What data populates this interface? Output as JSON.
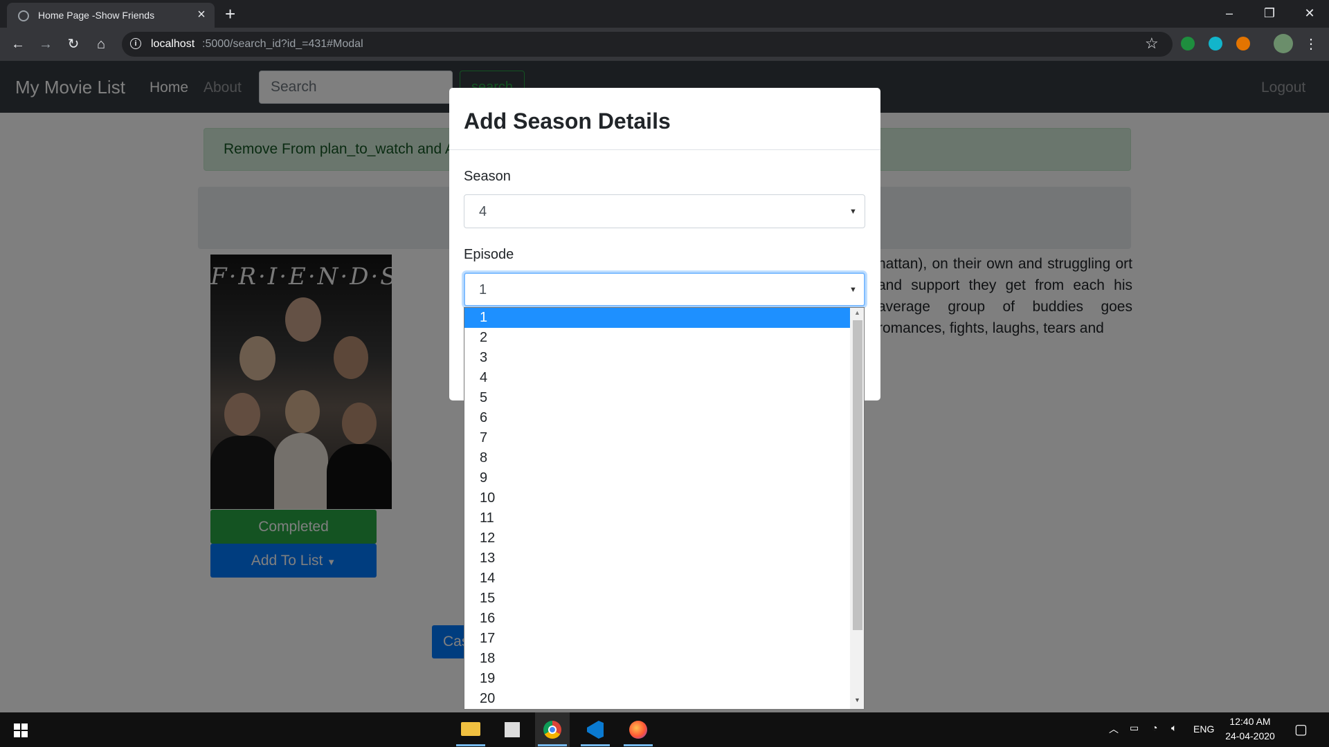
{
  "browser": {
    "tab_title": "Home Page -Show Friends",
    "url_host": "localhost",
    "url_path": ":5000/search_id?id_=431#Modal"
  },
  "navbar": {
    "brand": "My Movie List",
    "home": "Home",
    "about": "About",
    "search_placeholder": "Search",
    "search_button": "search",
    "logout": "Logout"
  },
  "alert": {
    "text": "Remove From plan_to_watch and A"
  },
  "show": {
    "poster_title": "F·R·I·E·N·D·S",
    "description": "hattan), on their own and struggling ort and support they get from each his average group of buddies goes romances, fights, laughs, tears and"
  },
  "buttons": {
    "completed": "Completed",
    "add_to_list": "Add To List",
    "cast": "Cas"
  },
  "modal": {
    "title": "Add Season Details",
    "season_label": "Season",
    "season_value": "4",
    "episode_label": "Episode",
    "episode_value": "1",
    "episode_options": [
      "1",
      "2",
      "3",
      "4",
      "5",
      "6",
      "7",
      "8",
      "9",
      "10",
      "11",
      "12",
      "13",
      "14",
      "15",
      "16",
      "17",
      "18",
      "19",
      "20"
    ],
    "selected_option": "1"
  },
  "taskbar": {
    "language": "ENG",
    "time": "12:40 AM",
    "date": "24-04-2020",
    "apps": [
      "file-explorer-icon",
      "store-icon",
      "chrome-icon",
      "vscode-icon",
      "firefox-icon"
    ]
  },
  "colors": {
    "navbar": "#343a40",
    "success": "#28a745",
    "primary": "#007bff",
    "highlight": "#1e90ff"
  }
}
